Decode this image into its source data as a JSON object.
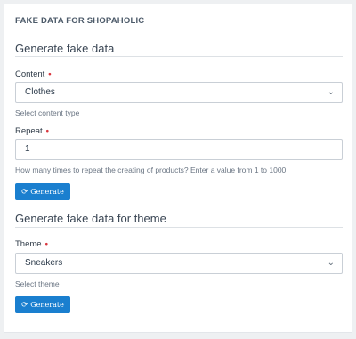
{
  "panel": {
    "title": "FAKE DATA FOR SHOPAHOLIC"
  },
  "section1": {
    "title": "Generate fake data",
    "content": {
      "label": "Content",
      "required_mark": "•",
      "value": "Clothes",
      "help": "Select content type"
    },
    "repeat": {
      "label": "Repeat",
      "required_mark": "•",
      "value": "1",
      "help": "How many times to repeat the creating of products? Enter a value from 1 to 1000"
    },
    "button": {
      "icon": "refresh-icon",
      "label": "Generate"
    }
  },
  "section2": {
    "title": "Generate fake data for theme",
    "theme": {
      "label": "Theme",
      "required_mark": "•",
      "value": "Sneakers",
      "help": "Select theme"
    },
    "button": {
      "icon": "refresh-icon",
      "label": "Generate"
    }
  },
  "colors": {
    "button": "#1a7fcf",
    "required": "#d9363e"
  }
}
